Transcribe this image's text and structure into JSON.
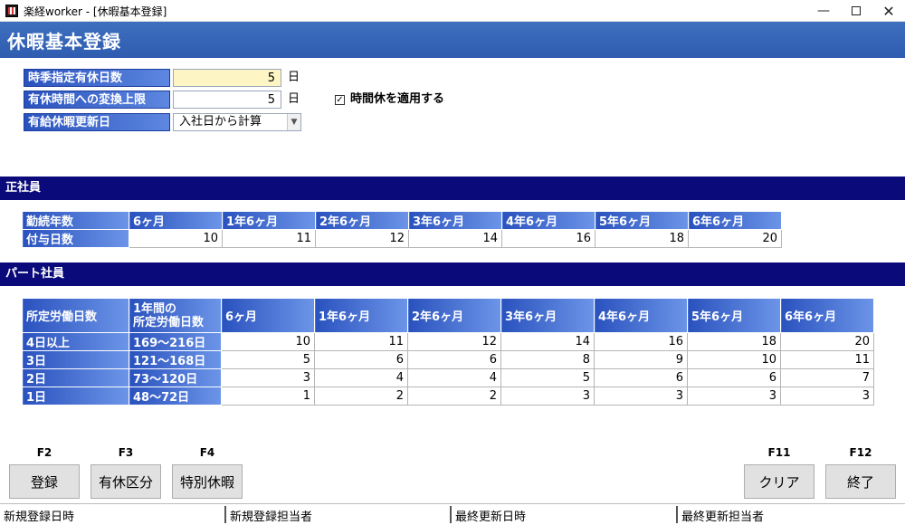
{
  "window": {
    "title": "楽経worker - [休暇基本登録]"
  },
  "page": {
    "title": "休暇基本登録"
  },
  "form": {
    "seasonal_days_label": "時季指定有休日数",
    "seasonal_days_value": "5",
    "hourly_limit_label": "有休時間への変換上限",
    "hourly_limit_value": "5",
    "unit_day": "日",
    "renewal_label": "有給休暇更新日",
    "renewal_value": "入社日から計算",
    "hourly_checkbox_label": "時間休を適用する",
    "hourly_checkbox_checked": true
  },
  "regular": {
    "section_title": "正社員",
    "row_header_years": "勤続年数",
    "row_header_days": "付与日数",
    "columns": [
      "6ヶ月",
      "1年6ヶ月",
      "2年6ヶ月",
      "3年6ヶ月",
      "4年6ヶ月",
      "5年6ヶ月",
      "6年6ヶ月"
    ],
    "values": [
      "10",
      "11",
      "12",
      "14",
      "16",
      "18",
      "20"
    ]
  },
  "part": {
    "section_title": "パート社員",
    "col_header_1": "所定労働日数",
    "col_header_2_line1": "1年間の",
    "col_header_2_line2": "所定労働日数",
    "columns": [
      "6ヶ月",
      "1年6ヶ月",
      "2年6ヶ月",
      "3年6ヶ月",
      "4年6ヶ月",
      "5年6ヶ月",
      "6年6ヶ月"
    ],
    "rows": [
      {
        "days": "4日以上",
        "range": "169～216日",
        "values": [
          "10",
          "11",
          "12",
          "14",
          "16",
          "18",
          "20"
        ]
      },
      {
        "days": "3日",
        "range": "121～168日",
        "values": [
          "5",
          "6",
          "6",
          "8",
          "9",
          "10",
          "11"
        ]
      },
      {
        "days": "2日",
        "range": "73～120日",
        "values": [
          "3",
          "4",
          "4",
          "5",
          "6",
          "6",
          "7"
        ]
      },
      {
        "days": "1日",
        "range": "48～72日",
        "values": [
          "1",
          "2",
          "2",
          "3",
          "3",
          "3",
          "3"
        ]
      }
    ]
  },
  "buttons": {
    "register_key": "F2",
    "register_label": "登録",
    "leave_type_key": "F3",
    "leave_type_label": "有休区分",
    "special_key": "F4",
    "special_label": "特別休暇",
    "clear_key": "F11",
    "clear_label": "クリア",
    "exit_key": "F12",
    "exit_label": "終了"
  },
  "status": {
    "created_at": "新規登録日時",
    "created_by": "新規登録担当者",
    "updated_at": "最終更新日時",
    "updated_by": "最終更新担当者"
  },
  "colors": {
    "header_blue": "#2e5cb0",
    "section_navy": "#0a0a7a",
    "cell_header_blue": "#2a52be",
    "highlight_yellow": "#fdf6c4"
  }
}
